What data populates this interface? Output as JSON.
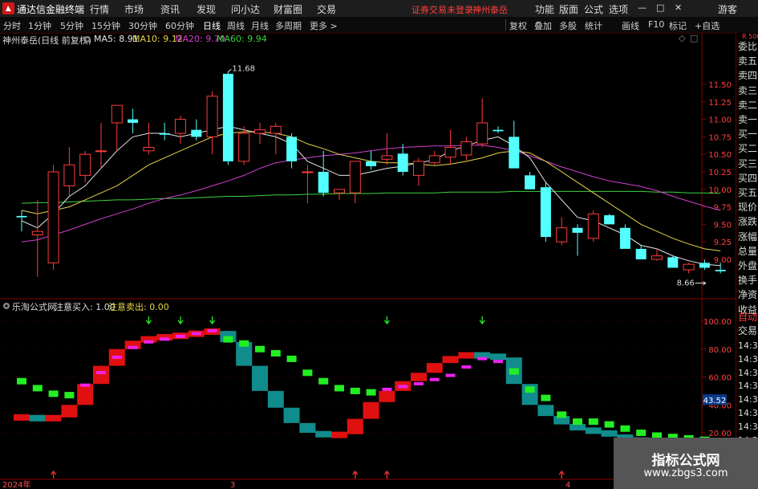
{
  "app": {
    "title": "通达信金融终端",
    "menu": [
      "行情",
      "市场",
      "资讯",
      "发现",
      "问小达",
      "财富圈",
      "交易"
    ],
    "status_warning": "证券交易未登录",
    "stock_name": "神州泰岳",
    "right_menu": [
      "功能",
      "版面",
      "公式",
      "选项"
    ],
    "guest": "游客",
    "window_controls": [
      "—",
      "□",
      "✕"
    ]
  },
  "toolbar": {
    "periods": [
      "分时",
      "1分钟",
      "5分钟",
      "15分钟",
      "30分钟",
      "60分钟",
      "日线",
      "周线",
      "月线",
      "多周期",
      "更多 >"
    ],
    "active_period": "日线",
    "tools": [
      "复权",
      "叠加",
      "多股",
      "统计",
      "画线",
      "F10",
      "标记",
      "+自选"
    ],
    "nav_icons": [
      "←",
      "→"
    ]
  },
  "main_chart": {
    "header_name": "神州泰岳(日线 前复权)",
    "ma5": "MA5: 8.91",
    "ma10": "MA10: 9.12",
    "ma20": "MA20: 9.70",
    "ma60": "MA60: 9.94",
    "high_label": "11.68",
    "low_label": "8.66",
    "y_ticks": [
      "11.50",
      "11.25",
      "11.00",
      "10.75",
      "10.50",
      "10.25",
      "10.00",
      "9.75",
      "9.50",
      "9.25",
      "9.00"
    ]
  },
  "indicator": {
    "name": "乐淘公式网",
    "buy_label": "注意买入: 1.00",
    "sell_label": "注意卖出: 0.00",
    "y_ticks": [
      "100.00",
      "80.00",
      "60.00",
      "40.00",
      "20.00"
    ],
    "current_value": "43.52"
  },
  "x_axis": {
    "labels": [
      "2024年",
      "3",
      "4"
    ]
  },
  "right_panel": {
    "top_label": "R 500",
    "items": [
      "委比",
      "卖五",
      "卖四",
      "卖三",
      "卖二",
      "卖一",
      "买一",
      "买二",
      "买三",
      "买四",
      "买五",
      "现价",
      "涨跌",
      "涨幅",
      "总量",
      "外盘",
      "换手",
      "净资",
      "收益"
    ],
    "lower_items": [
      "自动",
      "交易"
    ],
    "times": [
      "14:39",
      "14:39",
      "14:39",
      "14:39",
      "14:39",
      "14:39",
      "14:39",
      "14:39",
      "14:39",
      "14:39",
      "14:39"
    ]
  },
  "watermark": {
    "title": "指标公式网",
    "url": "www.zbgs3.com"
  },
  "colors": {
    "up": "#ff3b3b",
    "down": "#54ffff",
    "ma5": "#e6e6e6",
    "ma10": "#e6d44a",
    "ma20": "#d040d0",
    "ma60": "#3cd23c",
    "ind_up": "#e01010",
    "ind_down": "#108c8c"
  },
  "chart_data": [
    {
      "type": "candlestick",
      "title": "神州泰岳(日线 前复权)",
      "ylim": [
        8.7,
        11.75
      ],
      "candles": [
        {
          "o": 9.62,
          "h": 9.7,
          "l": 9.4,
          "c": 9.6
        },
        {
          "o": 9.35,
          "h": 9.85,
          "l": 8.75,
          "c": 9.4
        },
        {
          "o": 8.95,
          "h": 10.35,
          "l": 8.85,
          "c": 10.25
        },
        {
          "o": 10.05,
          "h": 10.6,
          "l": 9.9,
          "c": 10.35
        },
        {
          "o": 10.2,
          "h": 10.55,
          "l": 10.1,
          "c": 10.5
        },
        {
          "o": 10.55,
          "h": 10.95,
          "l": 10.3,
          "c": 10.55
        },
        {
          "o": 10.95,
          "h": 11.15,
          "l": 10.55,
          "c": 11.2
        },
        {
          "o": 11.0,
          "h": 11.15,
          "l": 10.8,
          "c": 10.95
        },
        {
          "o": 10.55,
          "h": 10.95,
          "l": 10.5,
          "c": 10.6
        },
        {
          "o": 10.8,
          "h": 10.95,
          "l": 10.7,
          "c": 10.78
        },
        {
          "o": 10.8,
          "h": 11.05,
          "l": 10.65,
          "c": 11.0
        },
        {
          "o": 10.85,
          "h": 11.0,
          "l": 10.7,
          "c": 10.75
        },
        {
          "o": 10.75,
          "h": 11.4,
          "l": 10.5,
          "c": 11.33
        },
        {
          "o": 11.65,
          "h": 11.68,
          "l": 10.35,
          "c": 10.4
        },
        {
          "o": 10.4,
          "h": 10.9,
          "l": 10.35,
          "c": 10.8
        },
        {
          "o": 10.8,
          "h": 10.95,
          "l": 10.65,
          "c": 10.85
        },
        {
          "o": 10.8,
          "h": 10.95,
          "l": 10.5,
          "c": 10.9
        },
        {
          "o": 10.75,
          "h": 10.8,
          "l": 10.3,
          "c": 10.4
        },
        {
          "o": 10.25,
          "h": 10.35,
          "l": 9.8,
          "c": 10.25
        },
        {
          "o": 10.25,
          "h": 10.55,
          "l": 9.9,
          "c": 9.95
        },
        {
          "o": 9.95,
          "h": 10.0,
          "l": 9.85,
          "c": 10.0
        },
        {
          "o": 9.95,
          "h": 10.4,
          "l": 9.8,
          "c": 10.4
        },
        {
          "o": 10.4,
          "h": 10.55,
          "l": 10.28,
          "c": 10.33
        },
        {
          "o": 10.43,
          "h": 10.8,
          "l": 10.35,
          "c": 10.48
        },
        {
          "o": 10.51,
          "h": 10.65,
          "l": 10.2,
          "c": 10.25
        },
        {
          "o": 10.2,
          "h": 10.45,
          "l": 10.05,
          "c": 10.4
        },
        {
          "o": 10.38,
          "h": 10.55,
          "l": 10.35,
          "c": 10.48
        },
        {
          "o": 10.46,
          "h": 10.85,
          "l": 10.35,
          "c": 10.6
        },
        {
          "o": 10.49,
          "h": 10.75,
          "l": 10.42,
          "c": 10.68
        },
        {
          "o": 10.65,
          "h": 11.3,
          "l": 10.6,
          "c": 10.95
        },
        {
          "o": 10.85,
          "h": 10.9,
          "l": 10.8,
          "c": 10.83
        },
        {
          "o": 10.75,
          "h": 10.98,
          "l": 10.3,
          "c": 10.3
        },
        {
          "o": 10.2,
          "h": 10.25,
          "l": 10.0,
          "c": 10.0
        },
        {
          "o": 10.03,
          "h": 10.1,
          "l": 9.25,
          "c": 9.32
        },
        {
          "o": 9.25,
          "h": 9.6,
          "l": 9.2,
          "c": 9.45
        },
        {
          "o": 9.45,
          "h": 9.5,
          "l": 9.05,
          "c": 9.38
        },
        {
          "o": 9.3,
          "h": 9.7,
          "l": 9.25,
          "c": 9.65
        },
        {
          "o": 9.63,
          "h": 9.65,
          "l": 9.5,
          "c": 9.5
        },
        {
          "o": 9.45,
          "h": 9.5,
          "l": 9.2,
          "c": 9.15
        },
        {
          "o": 9.15,
          "h": 9.2,
          "l": 9.0,
          "c": 9.0
        },
        {
          "o": 9.0,
          "h": 9.15,
          "l": 8.98,
          "c": 9.05
        },
        {
          "o": 9.03,
          "h": 9.05,
          "l": 8.88,
          "c": 8.88
        },
        {
          "o": 8.85,
          "h": 8.95,
          "l": 8.8,
          "c": 8.93
        },
        {
          "o": 8.95,
          "h": 9.0,
          "l": 8.85,
          "c": 8.88
        },
        {
          "o": 8.85,
          "h": 8.95,
          "l": 8.8,
          "c": 8.83
        }
      ],
      "ma5": [
        9.55,
        9.45,
        9.65,
        9.9,
        10.05,
        10.3,
        10.55,
        10.75,
        10.8,
        10.8,
        10.75,
        10.8,
        10.85,
        10.9,
        10.85,
        10.8,
        10.75,
        10.65,
        10.4,
        10.3,
        10.2,
        10.2,
        10.25,
        10.3,
        10.33,
        10.38,
        10.42,
        10.55,
        10.62,
        10.7,
        10.75,
        10.62,
        10.45,
        10.1,
        9.85,
        9.6,
        9.55,
        9.45,
        9.35,
        9.2,
        9.15,
        9.05,
        8.98,
        8.93,
        8.91
      ],
      "ma10": [
        9.7,
        9.65,
        9.7,
        9.75,
        9.85,
        9.95,
        10.05,
        10.2,
        10.35,
        10.45,
        10.55,
        10.65,
        10.75,
        10.8,
        10.82,
        10.82,
        10.8,
        10.75,
        10.65,
        10.58,
        10.5,
        10.45,
        10.4,
        10.38,
        10.38,
        10.36,
        10.34,
        10.36,
        10.4,
        10.45,
        10.52,
        10.55,
        10.52,
        10.4,
        10.25,
        10.1,
        9.95,
        9.8,
        9.65,
        9.5,
        9.4,
        9.3,
        9.22,
        9.15,
        9.12
      ],
      "ma20": [
        9.25,
        9.28,
        9.35,
        9.42,
        9.5,
        9.58,
        9.65,
        9.72,
        9.8,
        9.87,
        9.92,
        9.98,
        10.05,
        10.12,
        10.2,
        10.3,
        10.38,
        10.42,
        10.45,
        10.48,
        10.5,
        10.52,
        10.55,
        10.58,
        10.6,
        10.61,
        10.62,
        10.62,
        10.63,
        10.63,
        10.6,
        10.55,
        10.48,
        10.4,
        10.32,
        10.25,
        10.18,
        10.12,
        10.08,
        10.04,
        9.98,
        9.9,
        9.83,
        9.76,
        9.7
      ],
      "ma60": [
        9.8,
        9.81,
        9.81,
        9.82,
        9.83,
        9.84,
        9.85,
        9.85,
        9.86,
        9.87,
        9.87,
        9.88,
        9.89,
        9.9,
        9.9,
        9.91,
        9.92,
        9.92,
        9.93,
        9.93,
        9.94,
        9.94,
        9.94,
        9.95,
        9.95,
        9.95,
        9.95,
        9.96,
        9.96,
        9.96,
        9.96,
        9.97,
        9.97,
        9.97,
        9.97,
        9.97,
        9.97,
        9.97,
        9.97,
        9.97,
        9.96,
        9.96,
        9.95,
        9.95,
        9.94
      ]
    },
    {
      "type": "bar",
      "title": "乐淘公式网",
      "ylim": [
        10,
        110
      ],
      "trend": [
        31,
        30,
        31,
        40,
        55,
        68,
        80,
        86,
        88,
        89,
        90,
        92,
        93,
        85,
        68,
        50,
        38,
        27,
        20,
        18,
        19,
        30,
        42,
        50,
        57,
        63,
        70,
        75,
        76,
        75,
        74,
        55,
        40,
        32,
        26,
        22,
        21,
        18,
        15,
        14,
        13,
        12,
        12,
        12,
        11
      ],
      "signal": [
        57,
        52,
        48,
        47,
        53,
        62,
        73,
        80,
        84,
        86,
        88,
        90,
        92,
        87,
        84,
        80,
        77,
        73,
        63,
        57,
        52,
        50,
        49,
        50,
        52,
        54,
        57,
        60,
        66,
        72,
        70,
        64,
        51,
        45,
        33,
        28,
        28,
        26,
        23,
        20,
        18,
        17,
        16,
        15,
        14
      ],
      "buy_marks": [
        2,
        21,
        23,
        34
      ],
      "sell_marks": [
        8,
        10,
        12,
        23,
        29
      ]
    }
  ]
}
